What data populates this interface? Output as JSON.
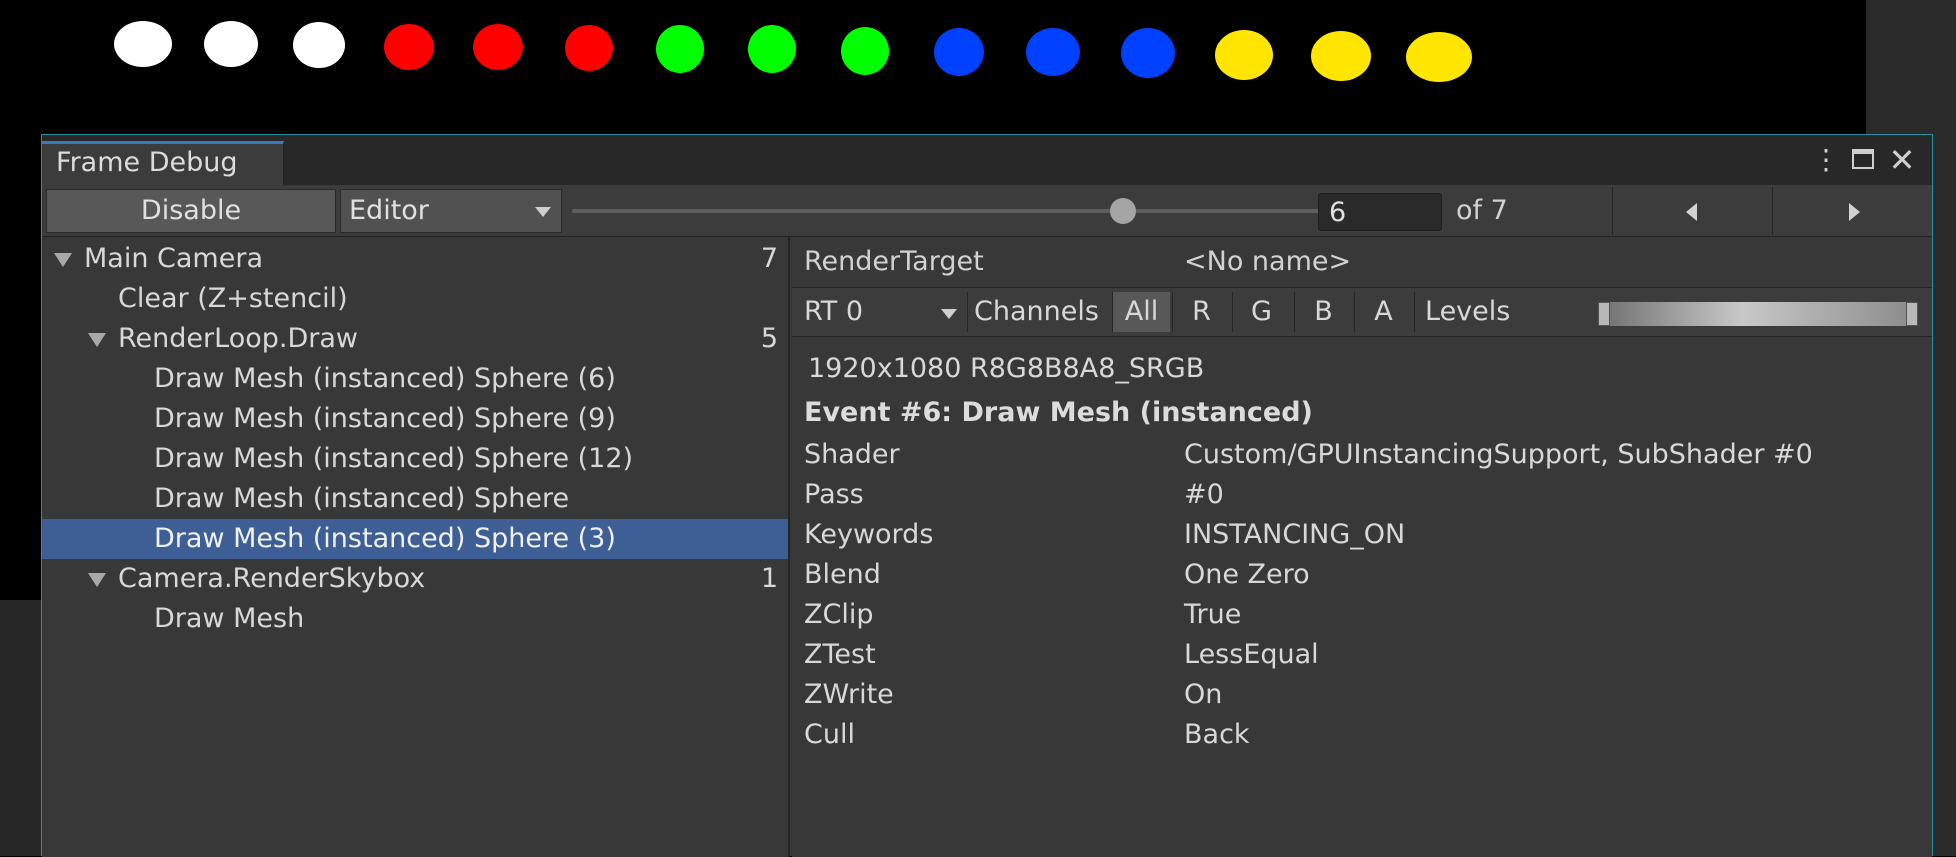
{
  "scene": {
    "background": "#000000",
    "spheres": [
      {
        "color": "#ffffff"
      },
      {
        "color": "#ffffff"
      },
      {
        "color": "#ffffff"
      },
      {
        "color": "#ff0000"
      },
      {
        "color": "#ff0000"
      },
      {
        "color": "#ff0000"
      },
      {
        "color": "#00ff00"
      },
      {
        "color": "#00ff00"
      },
      {
        "color": "#00ff00"
      },
      {
        "color": "#0040ff"
      },
      {
        "color": "#0040ff"
      },
      {
        "color": "#0040ff"
      },
      {
        "color": "#ffe500"
      },
      {
        "color": "#ffe500"
      },
      {
        "color": "#ffe500"
      }
    ]
  },
  "window": {
    "tab_title": "Frame Debug",
    "accent_color": "#3a79bb",
    "icons": [
      "kebab-menu-icon",
      "maximize-icon",
      "close-icon"
    ]
  },
  "toolbar": {
    "disable_label": "Disable",
    "target_value": "Editor",
    "event_index": "6",
    "event_total_label": "of 7",
    "slider": {
      "value": 6,
      "min": 1,
      "max": 7
    }
  },
  "tree": {
    "selected_color": "#3e5f96",
    "rows": [
      {
        "label": "Main Camera",
        "count": "7",
        "level": 0,
        "expandable": true,
        "selected": false
      },
      {
        "label": "Clear (Z+stencil)",
        "count": "",
        "level": 1,
        "expandable": false,
        "selected": false
      },
      {
        "label": "RenderLoop.Draw",
        "count": "5",
        "level": 1,
        "expandable": true,
        "selected": false
      },
      {
        "label": "Draw Mesh (instanced) Sphere (6)",
        "count": "",
        "level": 2,
        "expandable": false,
        "selected": false
      },
      {
        "label": "Draw Mesh (instanced) Sphere (9)",
        "count": "",
        "level": 2,
        "expandable": false,
        "selected": false
      },
      {
        "label": "Draw Mesh (instanced) Sphere (12)",
        "count": "",
        "level": 2,
        "expandable": false,
        "selected": false
      },
      {
        "label": "Draw Mesh (instanced) Sphere",
        "count": "",
        "level": 2,
        "expandable": false,
        "selected": false
      },
      {
        "label": "Draw Mesh (instanced) Sphere (3)",
        "count": "",
        "level": 2,
        "expandable": false,
        "selected": true
      },
      {
        "label": "Camera.RenderSkybox",
        "count": "1",
        "level": 1,
        "expandable": true,
        "selected": false
      },
      {
        "label": "Draw Mesh",
        "count": "",
        "level": 2,
        "expandable": false,
        "selected": false
      }
    ]
  },
  "details": {
    "render_target_label": "RenderTarget",
    "render_target_value": "<No name>",
    "rt_dropdown_value": "RT 0",
    "channels_label": "Channels",
    "channels": [
      {
        "label": "All",
        "active": true
      },
      {
        "label": "R",
        "active": false
      },
      {
        "label": "G",
        "active": false
      },
      {
        "label": "B",
        "active": false
      },
      {
        "label": "A",
        "active": false
      }
    ],
    "levels_label": "Levels",
    "format_info": "1920x1080 R8G8B8A8_SRGB",
    "event_title": "Event #6: Draw Mesh (instanced)",
    "properties": [
      {
        "name": "Shader",
        "value": "Custom/GPUInstancingSupport, SubShader #0"
      },
      {
        "name": "Pass",
        "value": "#0"
      },
      {
        "name": "Keywords",
        "value": "INSTANCING_ON"
      },
      {
        "name": "Blend",
        "value": "One Zero"
      },
      {
        "name": "ZClip",
        "value": "True"
      },
      {
        "name": "ZTest",
        "value": "LessEqual"
      },
      {
        "name": "ZWrite",
        "value": "On"
      },
      {
        "name": "Cull",
        "value": "Back"
      }
    ]
  }
}
